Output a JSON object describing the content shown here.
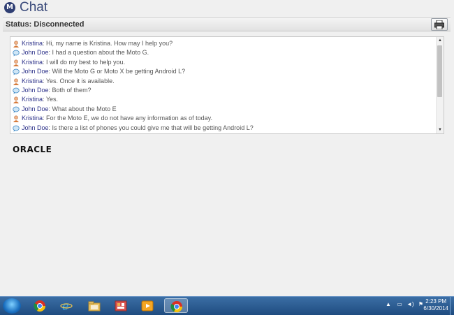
{
  "header": {
    "title": "Chat",
    "logo_glyph": "M"
  },
  "statusbar": {
    "status": "Status: Disconnected",
    "print_icon": "printer-icon"
  },
  "chat": {
    "messages": [
      {
        "author": "Kristina",
        "role": "agent",
        "text": ": Hi, my name is Kristina. How may I help you?"
      },
      {
        "author": "John Doe",
        "role": "user",
        "text": ": I had a question about the Moto G."
      },
      {
        "author": "Kristina",
        "role": "agent",
        "text": ": I will do my best to help you."
      },
      {
        "author": "John Doe",
        "role": "user",
        "text": ": Will the Moto G or Moto X be getting Android L?"
      },
      {
        "author": "Kristina",
        "role": "agent",
        "text": ": Yes. Once it is available."
      },
      {
        "author": "John Doe",
        "role": "user",
        "text": ": Both of them?"
      },
      {
        "author": "Kristina",
        "role": "agent",
        "text": ": Yes."
      },
      {
        "author": "John Doe",
        "role": "user",
        "text": ": What about the Moto E"
      },
      {
        "author": "Kristina",
        "role": "agent",
        "text": ": For the Moto E, we do not have any information as of today."
      },
      {
        "author": "John Doe",
        "role": "user",
        "text": ": Is there a list of phones you could give me that will be getting Android L?"
      }
    ]
  },
  "branding": {
    "oracle": "ORACLE"
  },
  "taskbar": {
    "apps": [
      "chrome-icon",
      "internet-explorer-icon",
      "file-explorer-icon",
      "app-icon",
      "media-player-icon",
      "chrome-icon"
    ],
    "clock_time": "2:23 PM",
    "clock_date": "6/30/2014"
  }
}
